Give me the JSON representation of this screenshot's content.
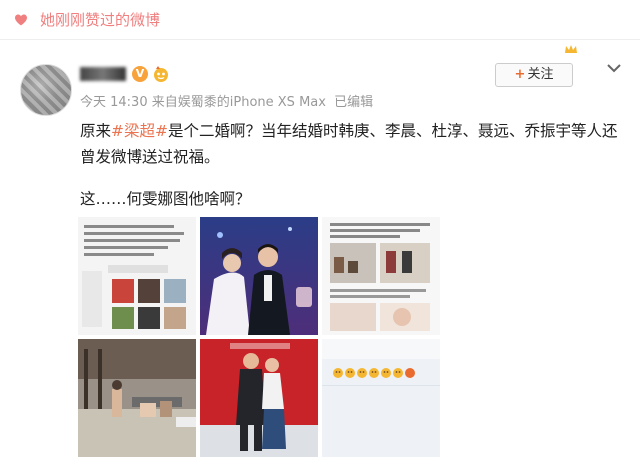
{
  "header": {
    "liked_text": "她刚刚赞过的微博",
    "heart_icon": "heart-icon",
    "accent": "#f08080"
  },
  "author": {
    "avatar_icon": "avatar",
    "vip_badge": "V",
    "level_icon": "level-badge-icon"
  },
  "meta": {
    "time": "今天 14:30",
    "from_label": "来自",
    "source": "娱蜀黍的iPhone XS Max",
    "edited": "已编辑"
  },
  "follow_button": {
    "plus": "+",
    "label": "关注"
  },
  "post": {
    "text_prefix": "原来",
    "tag": "#梁超#",
    "text_suffix": "是个二婚啊？当年结婚时韩庚、李晨、杜淳、聂远、乔振宇等人还曾发微博送过祝福。",
    "line2": "这……何雯娜图他啥啊？",
    "tag_color": "#eb7350"
  },
  "images": [
    {
      "name": "weibo-screenshot-image"
    },
    {
      "name": "wedding-photo-image"
    },
    {
      "name": "article-screenshot-image"
    },
    {
      "name": "beach-photo-image"
    },
    {
      "name": "couple-photo-image"
    },
    {
      "name": "emoji-comment-image"
    }
  ]
}
